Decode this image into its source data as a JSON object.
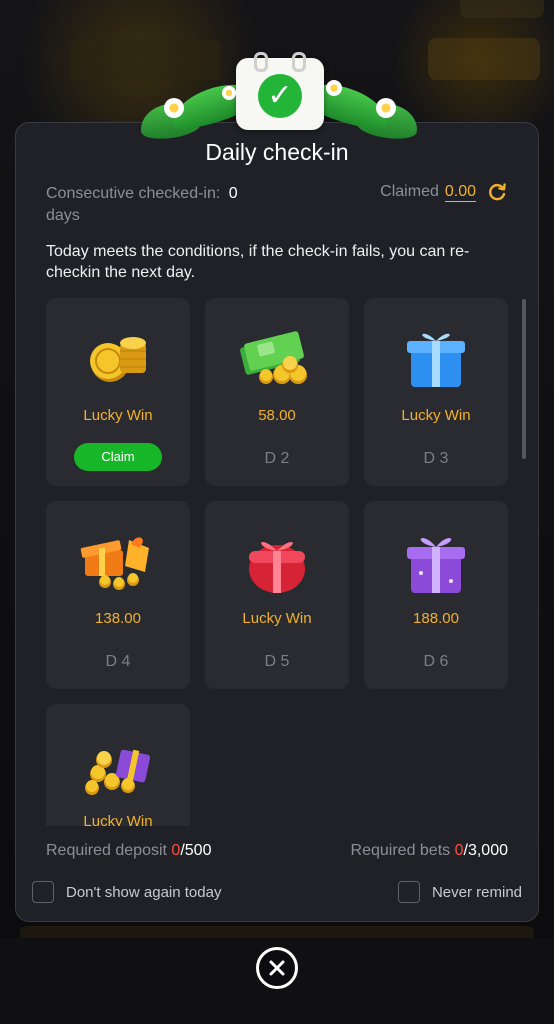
{
  "modal": {
    "title": "Daily check-in",
    "consecutive_label": "Consecutive checked-in:",
    "consecutive_value": "0",
    "consecutive_unit": "days",
    "claimed_label": "Claimed",
    "claimed_value": "0.00",
    "notice": "Today meets the conditions, if the check-in fails, you can re-checkin the next day."
  },
  "days": [
    {
      "reward": "Lucky Win",
      "day": "",
      "button": "Claim",
      "icon": "gold-coins-icon"
    },
    {
      "reward": "58.00",
      "day": "D 2",
      "icon": "cash-coins-icon"
    },
    {
      "reward": "Lucky Win",
      "day": "D 3",
      "icon": "blue-gift-icon"
    },
    {
      "reward": "138.00",
      "day": "D 4",
      "icon": "orange-gift-coins-icon"
    },
    {
      "reward": "Lucky Win",
      "day": "D 5",
      "icon": "red-gift-icon"
    },
    {
      "reward": "188.00",
      "day": "D 6",
      "icon": "purple-gift-icon"
    },
    {
      "reward": "Lucky Win",
      "day": "",
      "icon": "treasure-gift-icon"
    }
  ],
  "requirements": {
    "deposit_label": "Required deposit",
    "deposit_current": "0",
    "deposit_total": "/500",
    "bets_label": "Required bets",
    "bets_current": "0",
    "bets_total": "/3,000"
  },
  "options": {
    "dont_show_today": "Don't show again today",
    "never_remind": "Never remind"
  },
  "colors": {
    "accent": "#f3b12b",
    "claim_green": "#18b729",
    "warning_red": "#ff4b3e",
    "panel": "#202126",
    "card": "#2a2b31"
  }
}
